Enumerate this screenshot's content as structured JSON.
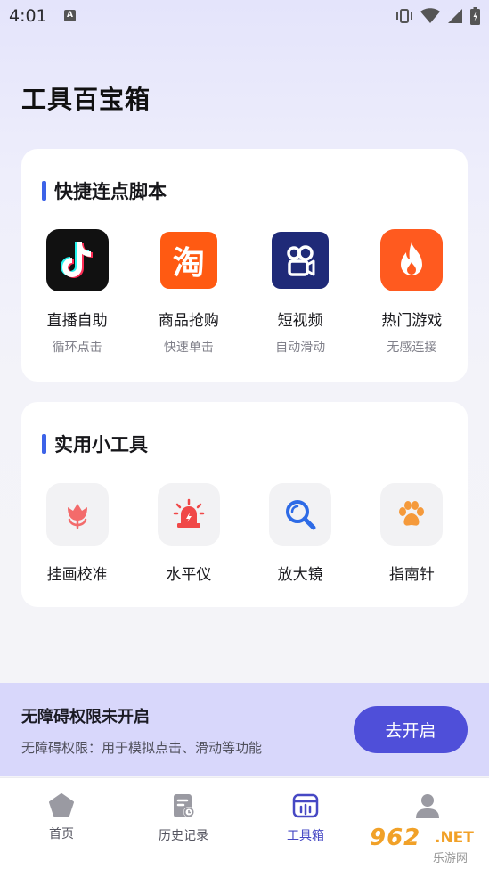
{
  "status_bar": {
    "time": "4:01",
    "notif_badge": "A"
  },
  "page_title": "工具百宝箱",
  "quick_scripts": {
    "title": "快捷连点脚本",
    "items": [
      {
        "label": "直播自助",
        "sub": "循环点击",
        "icon": "tiktok-app-icon",
        "bg": "#111111"
      },
      {
        "label": "商品抢购",
        "sub": "快速单击",
        "icon": "taobao-app-icon",
        "bg": "#ff5a12",
        "glyph": "淘"
      },
      {
        "label": "短视频",
        "sub": "自动滑动",
        "icon": "kuaishou-app-icon",
        "bg": "#1f2a78"
      },
      {
        "label": "热门游戏",
        "sub": "无感连接",
        "icon": "flame-app-icon",
        "bg": "#ff5a1f"
      }
    ]
  },
  "tools": {
    "title": "实用小工具",
    "items": [
      {
        "label": "挂画校准",
        "icon": "tulip-icon",
        "color": "#f36b6b"
      },
      {
        "label": "水平仪",
        "icon": "siren-icon",
        "color": "#f04848"
      },
      {
        "label": "放大镜",
        "icon": "magnifier-icon",
        "color": "#2e6be6"
      },
      {
        "label": "指南针",
        "icon": "paw-icon",
        "color": "#f59a3b"
      }
    ]
  },
  "accessibility_banner": {
    "title": "无障碍权限未开启",
    "desc": "无障碍权限：用于模拟点击、滑动等功能",
    "button": "去开启"
  },
  "nav": {
    "items": [
      {
        "label": "首页",
        "icon": "home-pentagon-icon"
      },
      {
        "label": "历史记录",
        "icon": "history-doc-icon"
      },
      {
        "label": "工具箱",
        "icon": "toolbox-icon",
        "active": true
      },
      {
        "label": "",
        "icon": "profile-icon"
      }
    ],
    "active_color": "#4648c4"
  },
  "watermark": {
    "brand": "962",
    "suffix": ".NET",
    "sub": "乐游网"
  }
}
